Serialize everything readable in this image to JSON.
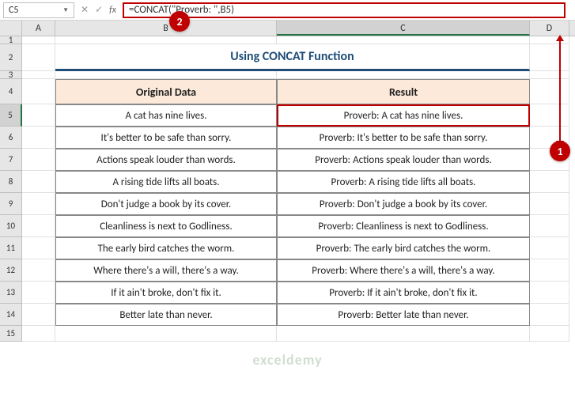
{
  "formula_bar": {
    "name_box": "C5",
    "formula": "=CONCAT(\"Proverb: \",B5)"
  },
  "columns": [
    "A",
    "B",
    "C",
    "D"
  ],
  "title": "Using CONCAT Function",
  "headers": {
    "original": "Original Data",
    "result": "Result"
  },
  "rows": [
    {
      "n": "1"
    },
    {
      "n": "2"
    },
    {
      "n": "3"
    },
    {
      "n": "4"
    },
    {
      "n": "5"
    },
    {
      "n": "6"
    },
    {
      "n": "7"
    },
    {
      "n": "8"
    },
    {
      "n": "9"
    },
    {
      "n": "10"
    },
    {
      "n": "11"
    },
    {
      "n": "12"
    },
    {
      "n": "13"
    },
    {
      "n": "14"
    },
    {
      "n": "15"
    }
  ],
  "data": [
    {
      "original": "A cat has nine lives.",
      "result": "Proverb: A cat has nine lives."
    },
    {
      "original": "It's better to be safe than sorry.",
      "result": "Proverb: It's better to be safe than sorry."
    },
    {
      "original": "Actions speak louder than words.",
      "result": "Proverb: Actions speak louder than words."
    },
    {
      "original": "A rising tide lifts all boats.",
      "result": "Proverb: A rising tide lifts all boats."
    },
    {
      "original": "Don't judge a book by its cover.",
      "result": "Proverb: Don't judge a book by its cover."
    },
    {
      "original": "Cleanliness is next to Godliness.",
      "result": "Proverb: Cleanliness is next to Godliness."
    },
    {
      "original": "The early bird catches the worm.",
      "result": "Proverb: The early bird catches the worm."
    },
    {
      "original": "Where there's a will, there's a way.",
      "result": "Proverb: Where there's a will, there's a way."
    },
    {
      "original": "If it ain't broke, don't fix it.",
      "result": "Proverb: If it ain't broke, don't fix it."
    },
    {
      "original": "Better late than never.",
      "result": "Proverb: Better late than never."
    }
  ],
  "callouts": {
    "c1": "1",
    "c2": "2"
  },
  "watermark": "exceldemy"
}
